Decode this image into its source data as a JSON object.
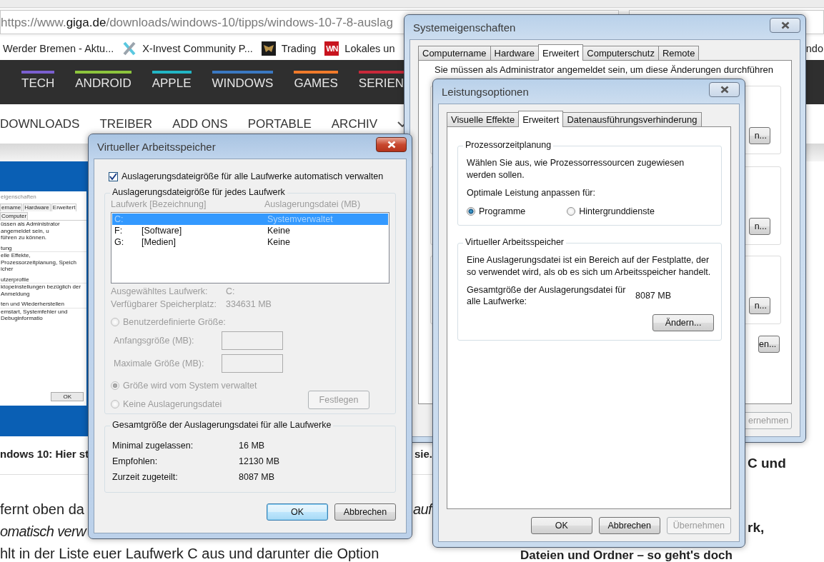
{
  "browser": {
    "address": {
      "prefix": "https://www.",
      "domain": "giga.de",
      "path": "/downloads/windows-10/tipps/windows-10-7-8-auslag"
    },
    "bookmarks": [
      {
        "label": "Werder Bremen - Aktu...",
        "kind": "plain"
      },
      {
        "label": "X-Invest Community P...",
        "kind": "x-mark"
      },
      {
        "label": "Trading",
        "kind": "emblem"
      },
      {
        "label": "Lokales un",
        "kind": "badge",
        "badge_text": "WN"
      }
    ],
    "bookmark_overflow": "ndo"
  },
  "site": {
    "nav": [
      {
        "label": "TECH",
        "color": "#7a5fd0"
      },
      {
        "label": "ANDROID",
        "color": "#8cc43c"
      },
      {
        "label": "APPLE",
        "color": "#22b5c4"
      },
      {
        "label": "WINDOWS",
        "color": "#3a78c2"
      },
      {
        "label": "GAMES",
        "color": "#f07a2a"
      },
      {
        "label": "SERIEN",
        "color": "#c8283a"
      }
    ],
    "subnav": [
      "DOWNLOADS",
      "TREIBER",
      "ADD ONS",
      "PORTABLE",
      "ARCHIV"
    ],
    "article_image": {
      "title": "eigenschaften",
      "tabs": [
        {
          "label": "ername",
          "selected": false
        },
        {
          "label": "Hardware",
          "selected": false
        },
        {
          "label": "Erweitert",
          "selected": true
        },
        {
          "label": "Computer",
          "selected": false
        }
      ],
      "lines": [
        {
          "kind": "text",
          "text": "üssen als Administrator angemeldet sein, u"
        },
        {
          "kind": "text",
          "text": "führen zu können."
        },
        {
          "kind": "heading",
          "text": "tung"
        },
        {
          "kind": "text",
          "text": "elle Effekte, Prozessorzeitplanung, Speich"
        },
        {
          "kind": "text",
          "text": "icher"
        },
        {
          "kind": "heading",
          "text": "utzerprofile"
        },
        {
          "kind": "text",
          "text": "ktopeinstellungen bezüglich der Anmeldung"
        },
        {
          "kind": "heading",
          "text": "ten und Wiederherstellen"
        },
        {
          "kind": "text",
          "text": "emstart, Systemfehler und Debuginformatio"
        }
      ],
      "button": "OK"
    },
    "caption": [
      "ndows 10: Hier st",
      "sie."
    ],
    "paragraph_lines": [
      [
        {
          "text": "fernt oben da",
          "italic": false
        },
        {
          "text": "auf",
          "italic": true
        }
      ],
      [
        {
          "text": "omatisch verw",
          "italic": true
        }
      ],
      [
        {
          "text": "hlt in der Liste euer Laufwerk C aus und darunter die Option",
          "italic": false
        }
      ]
    ],
    "sidebar_lines": [
      "C und",
      "rk,",
      "Dateien und Ordner – so geht's doch"
    ]
  },
  "windows": [
    {
      "kind": "system_properties",
      "title": "Systemeigenschaften",
      "active": false,
      "tabs": [
        {
          "label": "Computername",
          "selected": false
        },
        {
          "label": "Hardware",
          "selected": false
        },
        {
          "label": "Erweitert",
          "selected": true
        },
        {
          "label": "Computerschutz",
          "selected": false
        },
        {
          "label": "Remote",
          "selected": false
        }
      ],
      "notice": "Sie müssen als Administrator angemeldet sein, um diese Änderungen durchführen",
      "group_buttons": [
        "n...",
        "n...",
        "n..."
      ],
      "extra_button": "en...",
      "buttons": [
        {
          "label": "ernehmen",
          "disabled": true
        }
      ]
    },
    {
      "kind": "performance_options",
      "title": "Leistungsoptionen",
      "active": false,
      "tabs": [
        {
          "label": "Visuelle Effekte",
          "selected": false
        },
        {
          "label": "Erweitert",
          "selected": true
        },
        {
          "label": "Datenausführungsverhinderung",
          "selected": false
        }
      ],
      "scheduling": {
        "title": "Prozessorzeitplanung",
        "description": "Wählen Sie aus, wie Prozessorressourcen zugewiesen werden sollen.",
        "prompt": "Optimale Leistung anpassen für:",
        "options": [
          {
            "label": "Programme",
            "selected": true
          },
          {
            "label": "Hintergrunddienste",
            "selected": false
          }
        ]
      },
      "virtual_memory": {
        "title": "Virtueller Arbeitsspeicher",
        "description": "Eine Auslagerungsdatei ist ein Bereich auf der Festplatte, der so verwendet wird, als ob es sich um Arbeitsspeicher handelt.",
        "total_label": "Gesamtgröße der Auslagerungsdatei für alle Laufwerke:",
        "total_value": "8087 MB",
        "button": "Ändern..."
      },
      "buttons": [
        {
          "label": "OK",
          "disabled": false
        },
        {
          "label": "Abbrechen",
          "disabled": false
        },
        {
          "label": "Übernehmen",
          "disabled": true
        }
      ]
    },
    {
      "kind": "virtual_memory",
      "title": "Virtueller Arbeitsspeicher",
      "active": true,
      "auto_manage": {
        "label": "Auslagerungsdateigröße für alle Laufwerke automatisch verwalten",
        "checked": true
      },
      "drives_group": {
        "title": "Auslagerungsdateigröße für jedes Laufwerk",
        "disabled": true,
        "columns": [
          "Laufwerk [Bezeichnung]",
          "Auslagerungsdatei (MB)"
        ],
        "rows": [
          {
            "drive": "C:",
            "paging_file": "Systemverwaltet",
            "selected": true
          },
          {
            "drive": "F:",
            "label": "[Software]",
            "paging_file": "Keine",
            "selected": false
          },
          {
            "drive": "G:",
            "label": "[Medien]",
            "paging_file": "Keine",
            "selected": false
          }
        ],
        "info": [
          {
            "label": "Ausgewähltes Laufwerk:",
            "value": "C:"
          },
          {
            "label": "Verfügbarer Speicherplatz:",
            "value": "334631 MB"
          }
        ],
        "options": [
          {
            "label": "Benutzerdefinierte Größe:",
            "selected": false
          },
          {
            "label": "Größe wird vom System verwaltet",
            "selected": true
          },
          {
            "label": "Keine Auslagerungsdatei",
            "selected": false
          }
        ],
        "size_fields": [
          {
            "label": "Anfangsgröße (MB):"
          },
          {
            "label": "Maximale Größe (MB):"
          }
        ],
        "set_button": "Festlegen"
      },
      "totals_group": {
        "title": "Gesamtgröße der Auslagerungsdatei für alle Laufwerke",
        "rows": [
          {
            "label": "Minimal zugelassen:",
            "value": "16 MB"
          },
          {
            "label": "Empfohlen:",
            "value": "12130 MB"
          },
          {
            "label": "Zurzeit zugeteilt:",
            "value": "8087 MB"
          }
        ]
      },
      "buttons": [
        {
          "label": "OK",
          "default": true
        },
        {
          "label": "Abbrechen",
          "default": false
        }
      ]
    }
  ]
}
